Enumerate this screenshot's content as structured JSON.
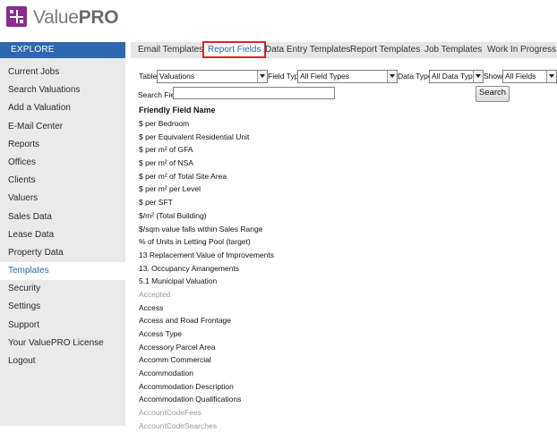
{
  "app": {
    "logo_light": "Value",
    "logo_bold": "PRO",
    "logo_icon": "valuepro-cross-icon",
    "accent": "#8b2a8f",
    "nav_blue": "#2f67b0",
    "highlight_red": "#d9262c"
  },
  "sidebar": {
    "header": "EXPLORE",
    "items": [
      {
        "label": "Current Jobs",
        "name": "sidebar-item-current-jobs",
        "active": false
      },
      {
        "label": "Search Valuations",
        "name": "sidebar-item-search-valuations",
        "active": false
      },
      {
        "label": "Add a Valuation",
        "name": "sidebar-item-add-valuation",
        "active": false
      },
      {
        "label": "E-Mail Center",
        "name": "sidebar-item-email-center",
        "active": false
      },
      {
        "label": "Reports",
        "name": "sidebar-item-reports",
        "active": false
      },
      {
        "label": "Offices",
        "name": "sidebar-item-offices",
        "active": false
      },
      {
        "label": "Clients",
        "name": "sidebar-item-clients",
        "active": false
      },
      {
        "label": "Valuers",
        "name": "sidebar-item-valuers",
        "active": false
      },
      {
        "label": "Sales Data",
        "name": "sidebar-item-sales-data",
        "active": false
      },
      {
        "label": "Lease Data",
        "name": "sidebar-item-lease-data",
        "active": false
      },
      {
        "label": "Property Data",
        "name": "sidebar-item-property-data",
        "active": false
      },
      {
        "label": "Templates",
        "name": "sidebar-item-templates",
        "active": true
      },
      {
        "label": "Security",
        "name": "sidebar-item-security",
        "active": false
      },
      {
        "label": "Settings",
        "name": "sidebar-item-settings",
        "active": false
      },
      {
        "label": "Support",
        "name": "sidebar-item-support",
        "active": false
      },
      {
        "label": "Your ValuePRO License",
        "name": "sidebar-item-license",
        "active": false
      },
      {
        "label": "Logout",
        "name": "sidebar-item-logout",
        "active": false
      }
    ]
  },
  "tabs": [
    {
      "label": "Email Templates",
      "name": "tab-email-templates",
      "active": false
    },
    {
      "label": "Report Fields",
      "name": "tab-report-fields",
      "active": true
    },
    {
      "label": "Data Entry Templates",
      "name": "tab-data-entry-templates",
      "active": false
    },
    {
      "label": "Report Templates",
      "name": "tab-report-templates",
      "active": false
    },
    {
      "label": "Job Templates",
      "name": "tab-job-templates",
      "active": false
    },
    {
      "label": "Work In Progress",
      "name": "tab-work-in-progress",
      "active": false
    }
  ],
  "filters": {
    "table_label": "Table:",
    "table_value": "Valuations",
    "field_type_label": "Field Type:",
    "field_type_value": "All Field Types",
    "data_type_label": "Data Type:",
    "data_type_value": "All Data Types",
    "show_label": "Show:",
    "show_value": "All Fields"
  },
  "search": {
    "label": "Search Field:",
    "value": "",
    "button": "Search"
  },
  "list": {
    "header": "Friendly Field Name",
    "items": [
      {
        "text": "$ per Bedroom",
        "muted": false
      },
      {
        "text": "$ per Equivalent Residential Unit",
        "muted": false
      },
      {
        "text": "$ per m² of GFA",
        "muted": false
      },
      {
        "text": "$ per m² of NSA",
        "muted": false
      },
      {
        "text": "$ per m² of Total Site Area",
        "muted": false
      },
      {
        "text": "$ per m² per Level",
        "muted": false
      },
      {
        "text": "$ per SFT",
        "muted": false
      },
      {
        "text": "$/m² (Total Building)",
        "muted": false
      },
      {
        "text": "$/sqm value falls within Sales Range",
        "muted": false
      },
      {
        "text": "% of Units in Letting Pool (target)",
        "muted": false
      },
      {
        "text": "13 Replacement Value of Improvements",
        "muted": false
      },
      {
        "text": "13. Occupancy Arrangements",
        "muted": false
      },
      {
        "text": "5.1 Municipal Valuation",
        "muted": false
      },
      {
        "text": "Accepted",
        "muted": true
      },
      {
        "text": "Access",
        "muted": false
      },
      {
        "text": "Access and Road Frontage",
        "muted": false
      },
      {
        "text": "Access Type",
        "muted": false
      },
      {
        "text": "Accessory Parcel Area",
        "muted": false
      },
      {
        "text": "Accomm Commercial",
        "muted": false
      },
      {
        "text": "Accommodation",
        "muted": false
      },
      {
        "text": "Accommodation Description",
        "muted": false
      },
      {
        "text": "Accommodation Qualifications",
        "muted": false
      },
      {
        "text": "AccountCodeFees",
        "muted": true
      },
      {
        "text": "AccountCodeSearches",
        "muted": true
      }
    ]
  }
}
